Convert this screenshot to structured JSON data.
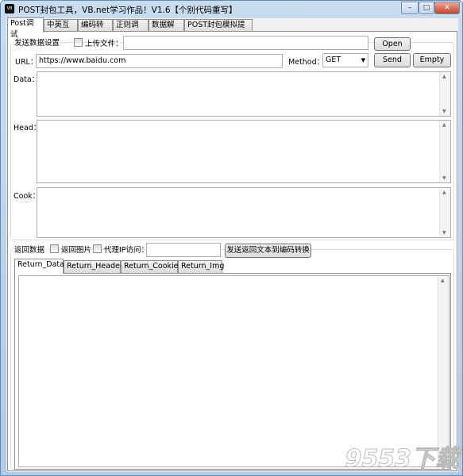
{
  "window": {
    "title": "POST封包工具，VB.net学习作品！V1.6【个别代码重写】",
    "icon_text": "VB",
    "minimize": "–",
    "maximize": "□",
    "close": "✕"
  },
  "tabs": [
    {
      "label": "Post调试"
    },
    {
      "label": "中英互译"
    },
    {
      "label": "编码转换"
    },
    {
      "label": "正则调试"
    },
    {
      "label": "数据解析"
    },
    {
      "label": "POST封包模拟提交"
    }
  ],
  "send": {
    "group_label": "发送数据设置",
    "upload_label": "上传文件：",
    "upload_value": "",
    "open_button": "Open",
    "url_label": "URL：",
    "url_value": "https://www.baidu.com",
    "method_label": "Method：",
    "method_value": "GET",
    "send_button": "Send",
    "empty_button": "Empty",
    "data_label": "Data：",
    "head_label": "Head：",
    "cook_label": "Cook："
  },
  "ret": {
    "group_label": "返回数据",
    "img_label": "返回图片",
    "proxy_label": "代理IP访问：",
    "proxy_value": "",
    "send_to_encode_button": "发送返回文本到编码转换",
    "tabs": [
      {
        "label": "Return_Data"
      },
      {
        "label": "Return_Header"
      },
      {
        "label": "Return_Cookie"
      },
      {
        "label": "Return_Img"
      }
    ]
  },
  "watermark": "9553下载"
}
